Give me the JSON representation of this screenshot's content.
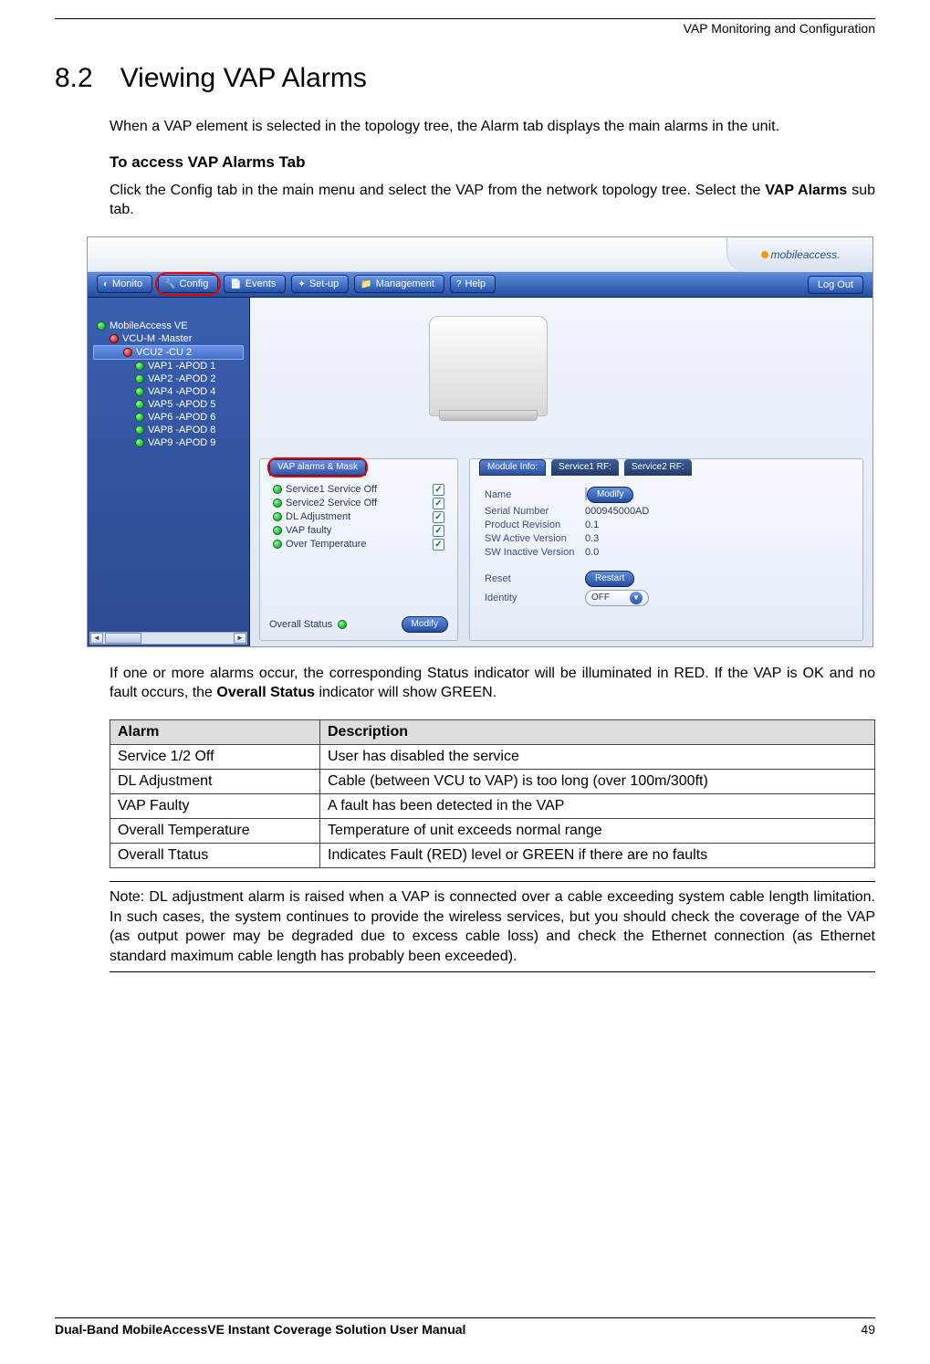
{
  "header": {
    "right": "VAP Monitoring and Configuration"
  },
  "section": {
    "number": "8.2",
    "title": "Viewing VAP Alarms"
  },
  "para1": "When a VAP element is selected in the topology tree, the Alarm tab displays the main alarms in the unit.",
  "subhead1": "To access VAP Alarms Tab",
  "para2_a": "Click the Config tab in the main menu and select the VAP from the network topology tree. Select the ",
  "para2_b": "VAP Alarms",
  "para2_c": " sub tab.",
  "app": {
    "brand": "mobileaccess.",
    "menu": {
      "monitor": "Monito",
      "config": "Config",
      "events": "Events",
      "setup": "Set-up",
      "management": "Management",
      "help": "Help",
      "logout": "Log Out"
    },
    "tree": {
      "root": "MobileAccess VE",
      "vcum": "VCU-M -Master",
      "vcu2": "VCU2 -CU 2",
      "items": [
        "VAP1 -APOD 1",
        "VAP2 -APOD 2",
        "VAP4 -APOD 4",
        "VAP5 -APOD 5",
        "VAP6 -APOD 6",
        "VAP8 -APOD 8",
        "VAP9 -APOD 9"
      ]
    },
    "alarms_panel": {
      "tab": "VAP alarms & Mask",
      "rows": [
        "Service1 Service Off",
        "Service2 Service Off",
        "DL Adjustment",
        "VAP faulty",
        "Over Temperature"
      ],
      "overall": "Overall Status",
      "modify": "Modify"
    },
    "info_panel": {
      "tabs": {
        "module": "Module Info:",
        "s1": "Service1 RF:",
        "s2": "Service2 RF:"
      },
      "fields": {
        "name": "Name",
        "serial": "Serial Number",
        "serial_v": "000945000AD",
        "rev": "Product Revision",
        "rev_v": "0.1",
        "swa": "SW Active Version",
        "swa_v": "0.3",
        "swi": "SW Inactive Version",
        "swi_v": "0.0",
        "reset": "Reset",
        "identity": "Identity",
        "identity_v": "OFF"
      },
      "modify": "Modify",
      "restart": "Restart"
    }
  },
  "para3_a": "If one or more alarms occur, the corresponding Status indicator will be illuminated in RED. If the VAP is OK and no fault occurs, the ",
  "para3_b": "Overall Status",
  "para3_c": " indicator will show GREEN.",
  "table": {
    "h1": "Alarm",
    "h2": "Description",
    "rows": [
      {
        "a": "Service 1/2 Off",
        "d": "User has disabled the service"
      },
      {
        "a": "DL Adjustment",
        "d": "Cable (between VCU to VAP) is too long (over 100m/300ft)"
      },
      {
        "a": "VAP Faulty",
        "d": "A fault has been detected in the VAP"
      },
      {
        "a": "Overall Temperature",
        "d": "Temperature of unit exceeds normal range"
      },
      {
        "a": "Overall Ttatus",
        "d": "Indicates Fault (RED) level or GREEN if there are no faults"
      }
    ]
  },
  "note": "Note: DL adjustment alarm is raised when a VAP is connected over a cable exceeding system cable length limitation. In such cases, the system continues to provide the wireless services, but you should check the coverage of the VAP (as output power may be degraded due to excess cable loss) and check the Ethernet connection (as Ethernet standard maximum cable length has probably been exceeded).",
  "footer": {
    "left": "Dual-Band MobileAccessVE Instant Coverage Solution User Manual",
    "right": "49"
  }
}
